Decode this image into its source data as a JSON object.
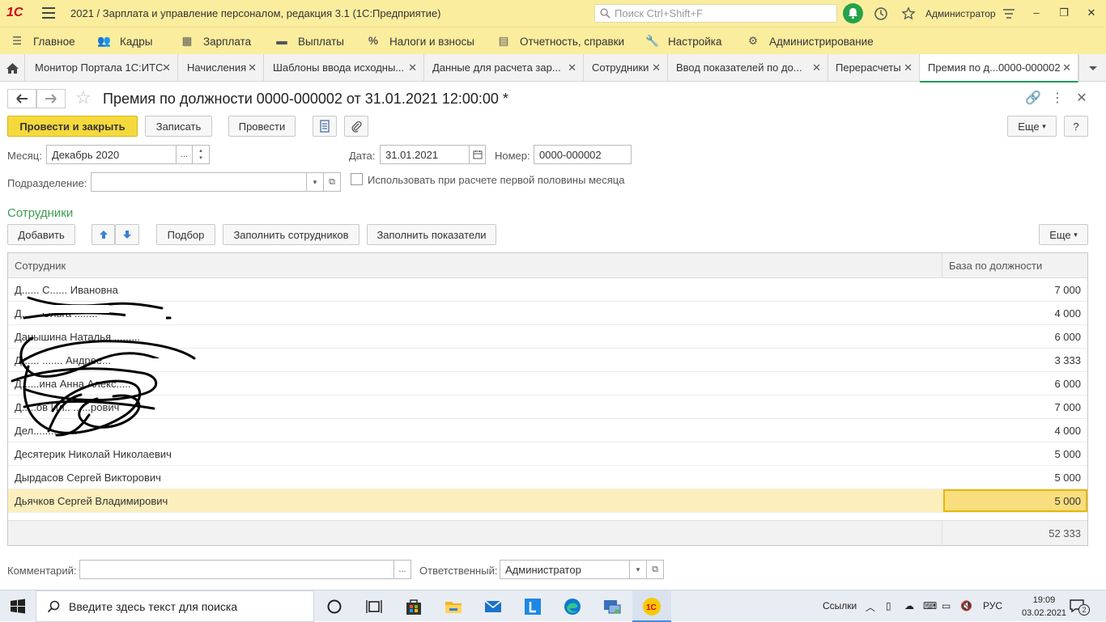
{
  "titlebar": {
    "logo": "1С",
    "title": "2021 / Зарплата и управление персоналом, редакция 3.1  (1С:Предприятие)",
    "search_placeholder": "Поиск Ctrl+Shift+F",
    "user": "Администратор"
  },
  "menu": [
    {
      "icon": "≡",
      "label": "Главное"
    },
    {
      "icon": "people-icon",
      "label": "Кадры"
    },
    {
      "icon": "calculator-icon",
      "label": "Зарплата"
    },
    {
      "icon": "wallet-icon",
      "label": "Выплаты"
    },
    {
      "icon": "%",
      "label": "Налоги и взносы"
    },
    {
      "icon": "report-icon",
      "label": "Отчетность, справки"
    },
    {
      "icon": "wrench-icon",
      "label": "Настройка"
    },
    {
      "icon": "gear-icon",
      "label": "Администрирование"
    }
  ],
  "tabs": [
    {
      "label": "Монитор Портала 1С:ИТС"
    },
    {
      "label": "Начисления"
    },
    {
      "label": "Шаблоны ввода исходны..."
    },
    {
      "label": "Данные для расчета зар..."
    },
    {
      "label": "Сотрудники"
    },
    {
      "label": "Ввод показателей по до..."
    },
    {
      "label": "Перерасчеты"
    },
    {
      "label": "Премия по д...0000-000002"
    }
  ],
  "document": {
    "title": "Премия по должности 0000-000002 от 31.01.2021 12:00:00 *",
    "post_close": "Провести и закрыть",
    "save": "Записать",
    "post": "Провести",
    "more": "Еще",
    "help": "?",
    "month_label": "Месяц:",
    "month_value": "Декабрь 2020",
    "date_label": "Дата:",
    "date_value": "31.01.2021",
    "number_label": "Номер:",
    "number_value": "0000-000002",
    "division_label": "Подразделение:",
    "division_value": "",
    "first_half_label": "Использовать при расчете первой половины месяца"
  },
  "employees": {
    "section_title": "Сотрудники",
    "add": "Добавить",
    "pick": "Подбор",
    "fill_employees": "Заполнить сотрудников",
    "fill_indicators": "Заполнить показатели",
    "more": "Еще",
    "col_employee": "Сотрудник",
    "col_base": "База по должности",
    "rows": [
      {
        "name": "Д...... С...... Ивановна",
        "base": "7 000"
      },
      {
        "name": "Д...... Ольга ........",
        "base": "4 000"
      },
      {
        "name": "Данышина Наталья .........",
        "base": "6 000"
      },
      {
        "name": "Д...... ....... Андрее...",
        "base": "3 333"
      },
      {
        "name": "Д......ина Анна Алекс.....",
        "base": "6 000"
      },
      {
        "name": "Д.....ов Ил.. ......рович",
        "base": "7 000"
      },
      {
        "name": "Дел........ ......",
        "base": "4 000"
      },
      {
        "name": "Десятерик Николай Николаевич",
        "base": "5 000"
      },
      {
        "name": "Дырдасов Сергей Викторович",
        "base": "5 000"
      },
      {
        "name": "Дьячков Сергей Владимирович",
        "base": "5 000"
      }
    ],
    "total": "52 333"
  },
  "footer": {
    "comment_label": "Комментарий:",
    "comment_value": "",
    "responsible_label": "Ответственный:",
    "responsible_value": "Администратор"
  },
  "taskbar": {
    "search_text": "Введите здесь текст для поиска",
    "links": "Ссылки",
    "lang": "РУС",
    "time": "19:09",
    "date": "03.02.2021",
    "notif_count": "2"
  }
}
